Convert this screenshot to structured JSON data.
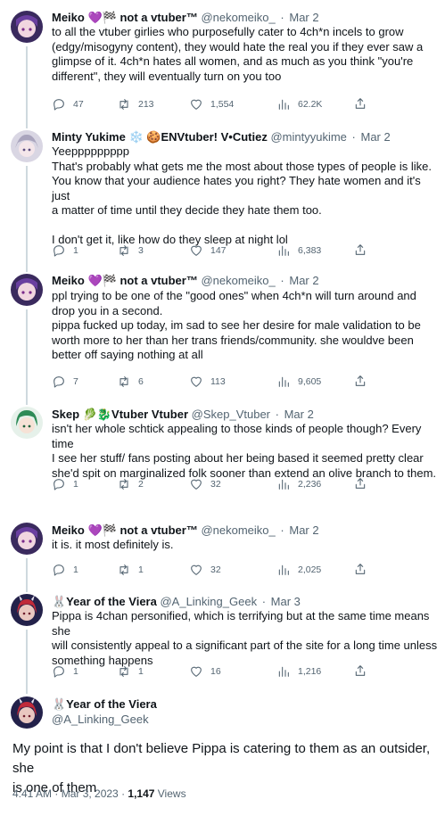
{
  "tweets": [
    {
      "name": "Meiko 💜🏁 not a vtuber™",
      "handle": "@nekomeiko_",
      "date": "Mar 2",
      "text": "to all the vtuber girlies who purposefully cater to 4ch*n incels to grow\n(edgy/misogyny content), they would hate the real you if they ever saw a\nglimpse of it. 4ch*n hates all women, and as much as you think \"you're\ndifferent\", they will eventually turn on you too",
      "replies": "47",
      "retweets": "213",
      "likes": "1,554",
      "views": "62.2K",
      "avatar_color": "#5b3a8c"
    },
    {
      "name": "Minty Yukime ❄️ 🍪ENVtuber! V•Cutiez",
      "handle": "@mintyyukime",
      "date": "Mar 2",
      "text": "Yeeppppppppp\nThat's probably what gets me the most about those types of people is like.\nYou know that your audience hates you right? They hate women and it's just\na matter of time until they decide they hate them too.\n\nI don't get it, like how do they sleep at night lol",
      "replies": "1",
      "retweets": "3",
      "likes": "147",
      "views": "6,383",
      "avatar_color": "#b9b6c6"
    },
    {
      "name": "Meiko 💜🏁 not a vtuber™",
      "handle": "@nekomeiko_",
      "date": "Mar 2",
      "text": "ppl trying to be one of the \"good ones\" when 4ch*n will turn around and\ndrop you in a second.\npippa fucked up today, im sad to see her desire for male validation to be\nworth more to her than her trans friends/community. she wouldve been\nbetter off saying nothing at all",
      "replies": "7",
      "retweets": "6",
      "likes": "113",
      "views": "9,605",
      "avatar_color": "#5b3a8c"
    },
    {
      "name": "Skep 🥬🐉Vtuber Vtuber",
      "handle": "@Skep_Vtuber",
      "date": "Mar 2",
      "text": "isn't her whole schtick appealing to those kinds of people though? Every time\nI see her stuff/ fans posting about her being based it seemed pretty clear\nshe'd spit on marginalized folk sooner than extend an olive branch to them.",
      "replies": "1",
      "retweets": "2",
      "likes": "32",
      "views": "2,236",
      "avatar_color": "#2e8b57"
    },
    {
      "name": "Meiko 💜🏁 not a vtuber™",
      "handle": "@nekomeiko_",
      "date": "Mar 2",
      "text": "it is. it most definitely is.",
      "replies": "1",
      "retweets": "1",
      "likes": "32",
      "views": "2,025",
      "avatar_color": "#5b3a8c"
    },
    {
      "name": "🐰Year of the Viera",
      "handle": "@A_Linking_Geek",
      "date": "Mar 3",
      "text": "Pippa is 4chan personified, which is terrifying but at the same time means she\nwill consistently appeal to a significant part of the site for a long time unless\nsomething happens",
      "replies": "1",
      "retweets": "1",
      "likes": "16",
      "views": "1,216",
      "avatar_color": "#2a2850"
    }
  ],
  "main_tweet": {
    "name": "🐰Year of the Viera",
    "handle": "@A_Linking_Geek",
    "text": "My point is that I don't believe Pippa is catering to them as an outsider, she\nis one of them",
    "time": "4:41 AM · Mar 3, 2023 · ",
    "views_count": "1,147",
    "views_label": " Views",
    "avatar_color": "#2a2850"
  }
}
